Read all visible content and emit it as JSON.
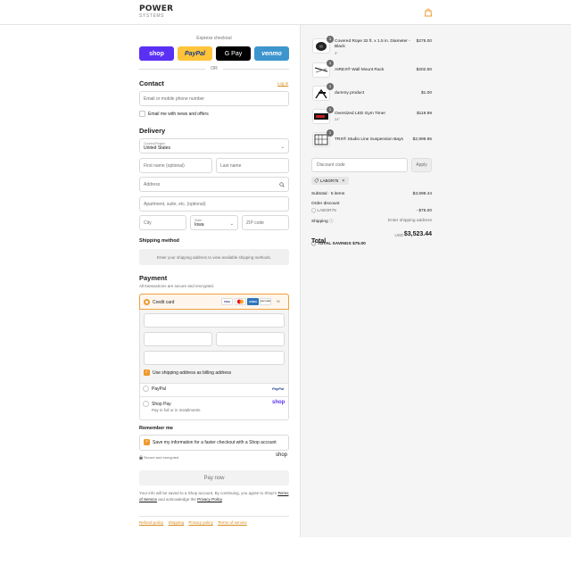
{
  "header": {
    "logo_main": "POWER",
    "logo_sub": "SYSTEMS"
  },
  "express": {
    "label": "Express checkout",
    "shop": "shop",
    "paypal": "PayPal",
    "gpay": "G Pay",
    "venmo": "venmo",
    "or": "OR"
  },
  "contact": {
    "heading": "Contact",
    "login": "Log in",
    "email_placeholder": "Email or mobile phone number",
    "newsletter": "Email me with news and offers"
  },
  "delivery": {
    "heading": "Delivery",
    "country_label": "Country/Region",
    "country_value": "United States",
    "first_name": "First name (optional)",
    "last_name": "Last name",
    "address": "Address",
    "apartment": "Apartment, suite, etc. (optional)",
    "city": "City",
    "state_label": "State",
    "state_value": "Iowa",
    "zip": "ZIP code"
  },
  "shipping": {
    "heading": "Shipping method",
    "note": "Enter your shipping address to view available shipping methods."
  },
  "payment": {
    "heading": "Payment",
    "subtext": "All transactions are secure and encrypted.",
    "credit_card": "Credit card",
    "card_logos": [
      "VISA",
      "MC",
      "AMEX",
      "DISCOVER",
      "+5"
    ],
    "billing_same": "Use shipping address as billing address",
    "paypal": "PayPal",
    "paypal_logo": "PayPal",
    "shop_pay": "Shop Pay",
    "shop_pay_sub": "Pay in full or in installments",
    "shop_pay_logo": "shop"
  },
  "remember": {
    "heading": "Remember me",
    "save_info": "Save my information for a faster checkout with a Shop account",
    "secure": "Secure and encrypted",
    "shop_logo": "shop"
  },
  "paynow": "Pay now",
  "legal": {
    "text1": "Your info will be saved to a Shop account. By continuing, you agree to Shop's",
    "terms": "Terms of Service",
    "text2": "and acknowledge the",
    "privacy": "Privacy Policy",
    "period": "."
  },
  "footer_links": [
    "Refund policy",
    "Shipping",
    "Privacy policy",
    "Terms of service"
  ],
  "order": {
    "items": [
      {
        "qty": "1",
        "name": "Covered Rope 32 ft. x 1.5 in. Diameter - Black",
        "sub": "3\"",
        "price": "$275.00"
      },
      {
        "qty": "1",
        "name": "AIREX® Wall Mount Rack",
        "sub": "",
        "price": "$202.50"
      },
      {
        "qty": "1",
        "name": "dummy product",
        "sub": "",
        "price": "$1.00"
      },
      {
        "qty": "1",
        "name": "Oversized LED Gym Timer",
        "sub": "24\"",
        "price": "$119.99"
      },
      {
        "qty": "1",
        "name": "TRX® Studio Line Suspension Bays",
        "sub": "",
        "price": "$2,999.95"
      }
    ],
    "discount_placeholder": "Discount code",
    "apply": "Apply",
    "applied_code": "LABOR75",
    "subtotal_label": "Subtotal · 5 items",
    "subtotal": "$3,598.44",
    "order_discount": "Order discount",
    "discount_code": "LABOR75",
    "discount_value": "- $75.00",
    "shipping_label": "Shipping",
    "shipping_value": "Enter shipping address",
    "total_label": "Total",
    "currency": "USD",
    "total": "$3,523.44",
    "savings_label": "TOTAL SAVINGS",
    "savings_value": "$75.00"
  }
}
